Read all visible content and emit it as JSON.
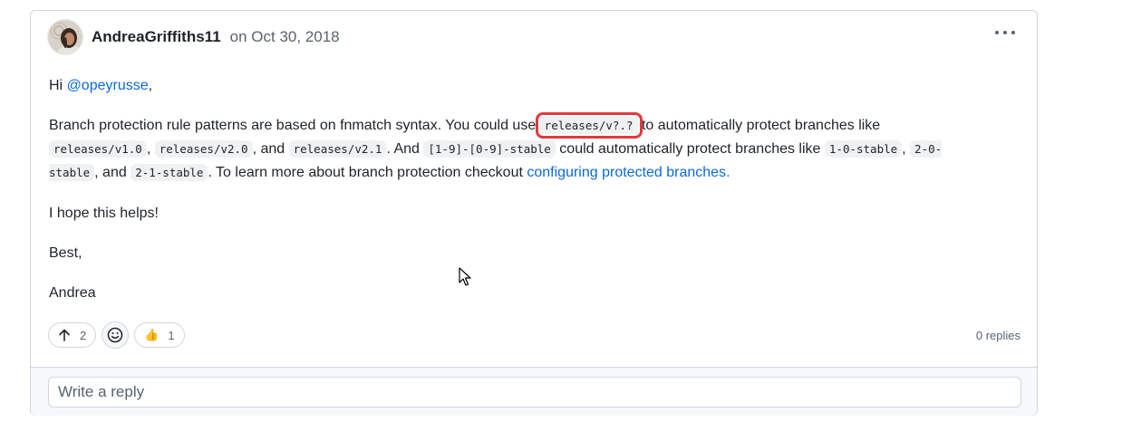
{
  "comment": {
    "author": "AndreaGriffiths11",
    "date": "on Oct 30, 2018",
    "greeting": {
      "prefix": "Hi ",
      "mention": "@opeyrusse",
      "suffix": ","
    },
    "paragraph": {
      "t1": "Branch protection rule patterns are based on fnmatch syntax. You could use ",
      "c1": "releases/v?.?",
      "t2": " to automatically protect branches like ",
      "c2": "releases/v1.0",
      "t3": ", ",
      "c3": "releases/v2.0",
      "t4": ", and ",
      "c4": "releases/v2.1",
      "t5": ". And ",
      "c5": "[1-9]-[0-9]-stable",
      "t6": " could automatically protect branches like ",
      "c6": "1-0-stable",
      "t7": ", ",
      "c7": "2-0-stable",
      "t8": ", and ",
      "c8": "2-1-stable",
      "t9": ". To learn more about branch protection checkout ",
      "link": "configuring protected branches."
    },
    "line3": "I hope this helps!",
    "line4": "Best,",
    "line5": "Andrea"
  },
  "reactions": {
    "upvote_count": "2",
    "thumbs_up_emoji": "👍",
    "thumbs_up_count": "1"
  },
  "replies_label": "0 replies",
  "reply_placeholder": "Write a reply",
  "colors": {
    "link": "#0969da",
    "highlight": "#e03a3e",
    "border": "#d0d7de"
  },
  "icons": [
    "avatar",
    "kebab-icon",
    "arrow-up-icon",
    "smiley-icon",
    "thumbs-up-icon",
    "mouse-cursor-icon"
  ]
}
